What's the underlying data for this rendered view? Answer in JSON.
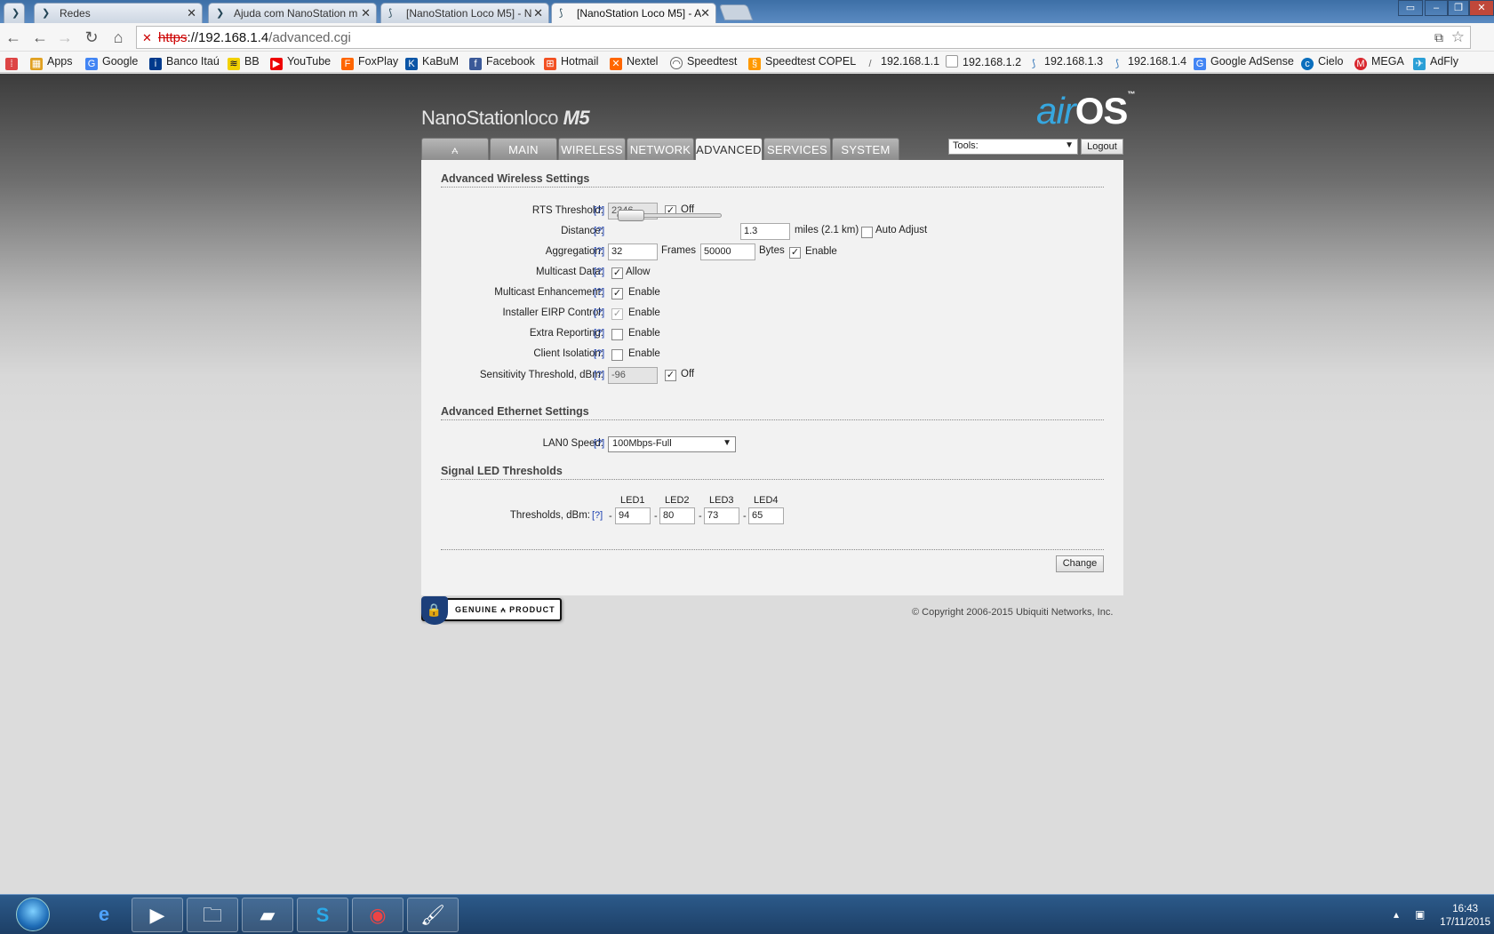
{
  "browser": {
    "tabs": [
      {
        "title": "Redes",
        "icon": "forum-icon"
      },
      {
        "title": "Ajuda com NanoStation m",
        "icon": "forum-icon"
      },
      {
        "title": "[NanoStation Loco M5] - N",
        "icon": "airos-icon"
      },
      {
        "title": "[NanoStation Loco M5] - A",
        "icon": "airos-icon"
      }
    ],
    "url_scheme": "https",
    "url_host": "://192.168.1.4",
    "url_path": "/advanced.cgi",
    "bookmarks": [
      "Apps",
      "Google",
      "Banco Itaú",
      "BB",
      "YouTube",
      "FoxPlay",
      "KaBuM",
      "Facebook",
      "Hotmail",
      "Nextel",
      "Speedtest",
      "Speedtest COPEL",
      "192.168.1.1",
      "192.168.1.2",
      "192.168.1.3",
      "192.168.1.4",
      "Google AdSense",
      "Cielo",
      "MEGA",
      "AdFly"
    ]
  },
  "header": {
    "brand_main": "NanoStation",
    "brand_thin": "loco",
    "brand_model": "M5",
    "airos_air": "air",
    "airos_os": "OS",
    "airos_tm": "™",
    "tabs": [
      "MAIN",
      "WIRELESS",
      "NETWORK",
      "ADVANCED",
      "SERVICES",
      "SYSTEM"
    ],
    "active_tab": "ADVANCED",
    "tools_label": "Tools:",
    "logout_label": "Logout"
  },
  "wireless": {
    "title": "Advanced Wireless Settings",
    "help": "[?]",
    "rts_label": "RTS Threshold:",
    "rts_value": "2346",
    "rts_off_label": "Off",
    "distance_label": "Distance:",
    "distance_value": "1.3",
    "distance_unit": "miles (2.1 km)",
    "auto_adjust_label": "Auto Adjust",
    "aggregation_label": "Aggregation:",
    "aggregation_frames": "32",
    "frames_label": "Frames",
    "aggregation_bytes": "50000",
    "bytes_label": "Bytes",
    "enable_label": "Enable",
    "multicast_data_label": "Multicast Data:",
    "allow_label": "Allow",
    "multicast_enh_label": "Multicast Enhancement:",
    "eirp_label": "Installer EIRP Control:",
    "extra_reporting_label": "Extra Reporting:",
    "client_isolation_label": "Client Isolation:",
    "sensitivity_label": "Sensitivity Threshold, dBm:",
    "sensitivity_value": "-96",
    "sensitivity_off_label": "Off"
  },
  "ethernet": {
    "title": "Advanced Ethernet Settings",
    "lan0_label": "LAN0 Speed:",
    "lan0_value": "100Mbps-Full"
  },
  "led": {
    "title": "Signal LED Thresholds",
    "headers": [
      "LED1",
      "LED2",
      "LED3",
      "LED4"
    ],
    "label": "Thresholds, dBm:",
    "values": [
      "94",
      "80",
      "73",
      "65"
    ],
    "dash": "-"
  },
  "actions": {
    "change_label": "Change"
  },
  "footer": {
    "genuine_label": "GENUINE",
    "product_label": "PRODUCT",
    "copyright": "© Copyright 2006-2015 Ubiquiti Networks, Inc."
  },
  "taskbar": {
    "time": "16:43",
    "date": "17/11/2015"
  },
  "colors": {
    "accent_blue": "#36a7e0",
    "help_link": "#1a3fb0"
  }
}
